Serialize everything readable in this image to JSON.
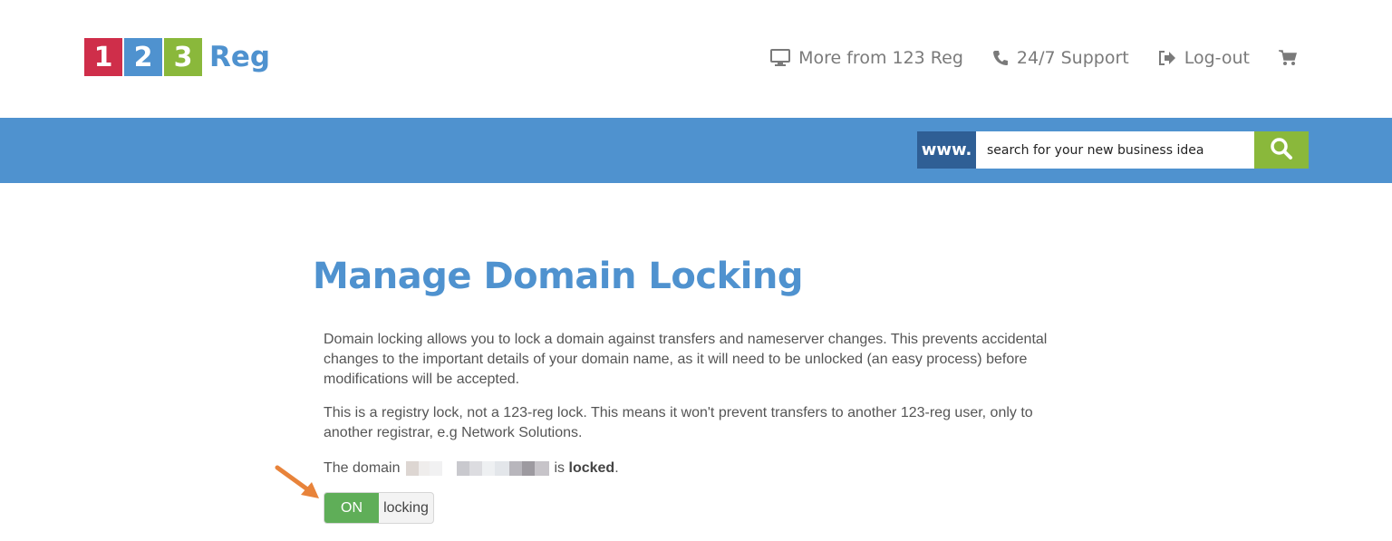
{
  "logo": {
    "digits": [
      "1",
      "2",
      "3"
    ],
    "word": "Reg"
  },
  "topnav": {
    "items": [
      {
        "label": "More from 123 Reg",
        "icon": "monitor-icon"
      },
      {
        "label": "24/7 Support",
        "icon": "phone-icon"
      },
      {
        "label": "Log-out",
        "icon": "logout-icon"
      }
    ],
    "cart_icon": "cart-icon"
  },
  "search": {
    "prefix": "www.",
    "placeholder": "search for your new business idea",
    "button_icon": "search-icon"
  },
  "main": {
    "title": "Manage Domain Locking",
    "paragraph1": "Domain locking allows you to lock a domain against transfers and nameserver changes. This prevents accidental changes to the important details of your domain name, as it will need to be unlocked (an easy process) before modifications will be accepted.",
    "paragraph2": "This is a registry lock, not a 123-reg lock. This means it won't prevent transfers to another 123-reg user, only to another registrar, e.g Network Solutions.",
    "status_prefix": "The domain",
    "status_middle": "is",
    "status_value": "locked",
    "status_suffix": ".",
    "toggle": {
      "state_label": "ON",
      "label": "locking",
      "enabled": true
    }
  },
  "colors": {
    "brand_blue": "#4f92cf",
    "brand_red": "#cf2e4a",
    "brand_green": "#8ab83b",
    "toggle_green": "#5fae58",
    "www_bg": "#2f5f95",
    "annotation_arrow": "#e8833a"
  }
}
